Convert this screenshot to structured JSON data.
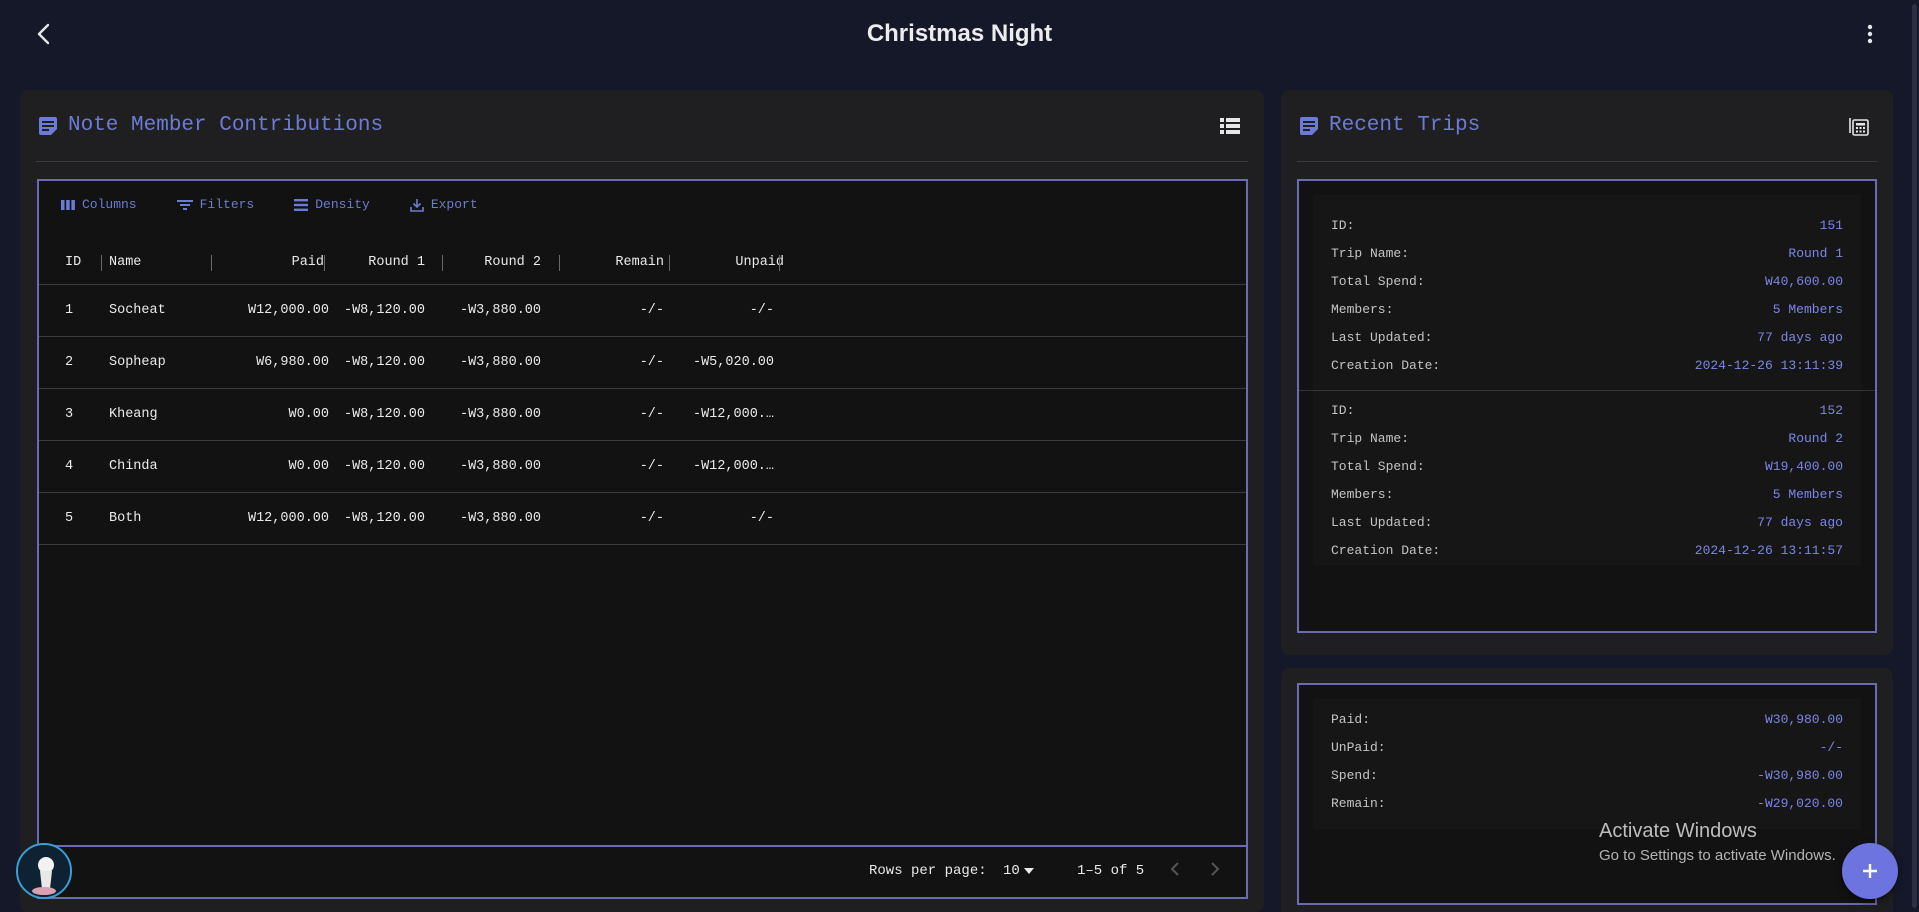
{
  "header": {
    "title": "Christmas Night"
  },
  "contributions": {
    "title": "Note Member Contributions",
    "toolbar": {
      "columns": "Columns",
      "filters": "Filters",
      "density": "Density",
      "export": "Export"
    },
    "columns": [
      "ID",
      "Name",
      "Paid",
      "Round 1",
      "Round 2",
      "Remain",
      "Unpaid"
    ],
    "rows": [
      {
        "id": "1",
        "name": "Socheat",
        "paid": "W12,000.00",
        "round1": "-W8,120.00",
        "round2": "-W3,880.00",
        "remain": "-/-",
        "unpaid": "-/-"
      },
      {
        "id": "2",
        "name": "Sopheap",
        "paid": "W6,980.00",
        "round1": "-W8,120.00",
        "round2": "-W3,880.00",
        "remain": "-/-",
        "unpaid": "-W5,020.00"
      },
      {
        "id": "3",
        "name": "Kheang",
        "paid": "W0.00",
        "round1": "-W8,120.00",
        "round2": "-W3,880.00",
        "remain": "-/-",
        "unpaid": "-W12,000.…"
      },
      {
        "id": "4",
        "name": "Chinda",
        "paid": "W0.00",
        "round1": "-W8,120.00",
        "round2": "-W3,880.00",
        "remain": "-/-",
        "unpaid": "-W12,000.…"
      },
      {
        "id": "5",
        "name": "Both",
        "paid": "W12,000.00",
        "round1": "-W8,120.00",
        "round2": "-W3,880.00",
        "remain": "-/-",
        "unpaid": "-/-"
      }
    ],
    "footer": {
      "rows_per_page_label": "Rows per page:",
      "rows_per_page": "10",
      "range": "1–5 of 5"
    }
  },
  "recent_trips": {
    "title": "Recent Trips",
    "trips": [
      {
        "id_label": "ID:",
        "id": "151",
        "name_label": "Trip Name:",
        "name": "Round 1",
        "spend_label": "Total Spend:",
        "spend": "W40,600.00",
        "members_label": "Members:",
        "members": "5 Members",
        "updated_label": "Last Updated:",
        "updated": "77 days ago",
        "created_label": "Creation Date:",
        "created": "2024-12-26 13:11:39"
      },
      {
        "id_label": "ID:",
        "id": "152",
        "name_label": "Trip Name:",
        "name": "Round 2",
        "spend_label": "Total Spend:",
        "spend": "W19,400.00",
        "members_label": "Members:",
        "members": "5 Members",
        "updated_label": "Last Updated:",
        "updated": "77 days ago",
        "created_label": "Creation Date:",
        "created": "2024-12-26 13:11:57"
      }
    ]
  },
  "summary": {
    "paid_label": "Paid:",
    "paid": "W30,980.00",
    "unpaid_label": "UnPaid:",
    "unpaid": "-/-",
    "spend_label": "Spend:",
    "spend": "-W30,980.00",
    "remain_label": "Remain:",
    "remain": "-W29,020.00"
  },
  "watermark": {
    "line1": "Activate Windows",
    "line2": "Go to Settings to activate Windows."
  },
  "colors": {
    "accent": "#6c7bd4",
    "background": "#141829",
    "card": "#1f1f21",
    "grid_border": "#6a6bb0",
    "value": "#7d86e8"
  }
}
